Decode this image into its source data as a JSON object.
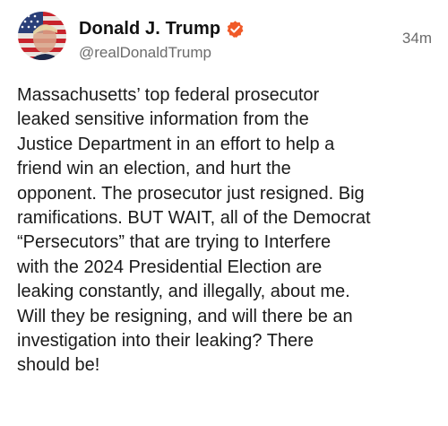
{
  "post": {
    "author": {
      "display_name": "Donald J. Trump",
      "handle": "@realDonaldTrump",
      "verified_badge_icon": "verified-badge-icon",
      "verified_color": "#f05a28"
    },
    "timestamp": "34m",
    "body_lines": [
      "Massachusetts’ top federal prosecutor",
      "leaked sensitive information from the",
      "Justice Department in an effort to help a",
      "friend win an election, and hurt the",
      "opponent. The prosecutor just resigned. Big",
      "ramifications. BUT WAIT, all of the Democrat",
      "“Persecutors” that are trying to Interfere",
      "with the 2024 Presidential Election are",
      "leaking constantly, and illegally, about me.",
      "Will they be resigning, and will there be an",
      "investigation into their leaking? There",
      "should be!"
    ]
  }
}
